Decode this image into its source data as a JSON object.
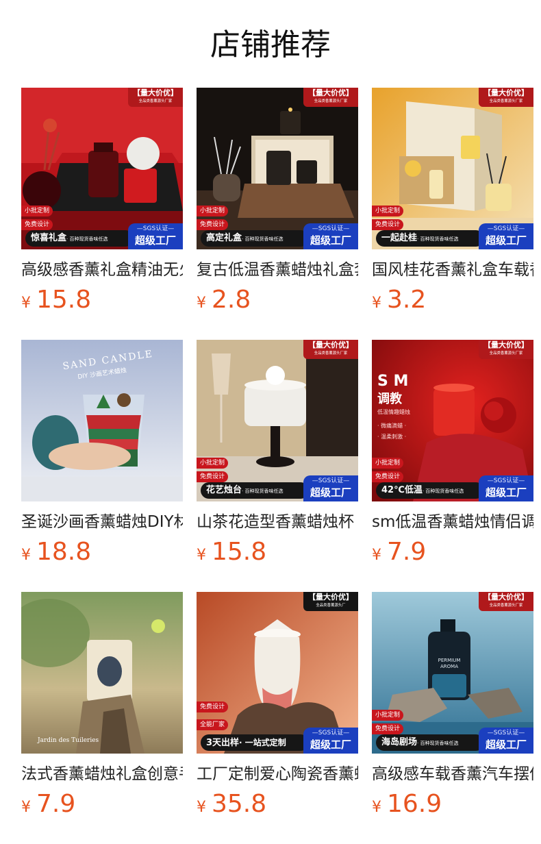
{
  "page": {
    "title": "店铺推荐"
  },
  "products": [
    {
      "name": "高级感香薰礼盒精油无火香薰",
      "currency": "¥",
      "price": "15.8",
      "badges": {
        "top": "【量大价优】",
        "top_sub": "全品类香薰源头厂家",
        "side": [
          "小批定制",
          "免费设计"
        ],
        "bar_main": "惊喜礼盒",
        "bar_sub": "· 百种现货香味任选",
        "factory_top": "—SGS认证—",
        "factory_main": "超级工厂"
      },
      "colors": {
        "bg1": "#c4161c",
        "bg2": "#7a0d10",
        "accent": "#e7e2dc"
      }
    },
    {
      "name": "复古低温香薰蜡烛礼盒套装",
      "currency": "¥",
      "price": "2.8",
      "badges": {
        "top": "【量大价优】",
        "top_sub": "全品类香薰源头厂家",
        "side": [
          "小批定制",
          "免费设计"
        ],
        "bar_main": "高定礼盒",
        "bar_sub": "· 百种现货香味任选",
        "factory_top": "—SGS认证—",
        "factory_main": "超级工厂"
      },
      "colors": {
        "bg1": "#1c1612",
        "bg2": "#5a4331",
        "accent": "#e8dcc8"
      }
    },
    {
      "name": "国风桂花香薰礼盒车载香薰",
      "currency": "¥",
      "price": "3.2",
      "badges": {
        "top": "【量大价优】",
        "top_sub": "全品类香薰源头厂家",
        "side": [
          "小批定制",
          "免费设计"
        ],
        "bar_main": "一起赴桂",
        "bar_sub": "· 百种现货香味任选",
        "factory_top": "—SGS认证—",
        "factory_main": "超级工厂"
      },
      "colors": {
        "bg1": "#e0a237",
        "bg2": "#f4e6c6",
        "accent": "#f3e9d2"
      }
    },
    {
      "name": "圣诞沙画香薰蜡烛DIY材料包",
      "currency": "¥",
      "price": "18.8",
      "badges": {
        "script_title": "SAND CANDLE",
        "script_sub": "DIY 沙画艺术蜡烛"
      },
      "colors": {
        "bg1": "#b7c2db",
        "bg2": "#e6e9f1",
        "accent": "#c8252b"
      }
    },
    {
      "name": "山茶花造型香薰蜡烛杯",
      "currency": "¥",
      "price": "15.8",
      "badges": {
        "top": "【量大价优】",
        "top_sub": "全品类香薰源头厂家",
        "side": [
          "小批定制",
          "免费设计"
        ],
        "bar_main": "花艺烛台",
        "bar_sub": "· 百种现货香味任选",
        "factory_top": "—SGS认证—",
        "factory_main": "超级工厂"
      },
      "colors": {
        "bg1": "#d7c6a6",
        "bg2": "#3a2b22",
        "accent": "#f3f1ec"
      }
    },
    {
      "name": "sm低温香薰蜡烛情侣调情",
      "currency": "¥",
      "price": "7.9",
      "badges": {
        "top": "【量大价优】",
        "top_sub": "全品类香薰源头厂家",
        "side": [
          "小批定制",
          "免费设计"
        ],
        "bar_main": "42℃低温",
        "bar_sub": "· 百种现货香味任选",
        "factory_top": "—SGS认证—",
        "factory_main": "超级工厂",
        "sm_title": "S M",
        "sm_sub": "调教",
        "sm_lines": [
          "低温情趣蜡烛",
          "· 微痛滴蜡 ·",
          "· 温柔刺激 ·"
        ]
      },
      "colors": {
        "bg1": "#8d0d10",
        "bg2": "#d4171c",
        "accent": "#e23a2f"
      }
    },
    {
      "name": "法式香薰蜡烛礼盒创意手工",
      "currency": "¥",
      "price": "7.9",
      "badges": {
        "label_line": "Jardin des Tuileries"
      },
      "colors": {
        "bg1": "#8fa86a",
        "bg2": "#d6c7a2",
        "accent": "#efe7d4"
      }
    },
    {
      "name": "工厂定制爱心陶瓷香薰蜡烛",
      "currency": "¥",
      "price": "35.8",
      "badges": {
        "top": "【量大价优】",
        "top_sub": "全品类香薰源头厂",
        "side": [
          "免费设计",
          "全能厂家"
        ],
        "bar_main": "3天出样",
        "bar_sub": "· 一站式定制",
        "factory_top": "—SGS认证—",
        "factory_main": "超级工厂"
      },
      "colors": {
        "bg1": "#c6582f",
        "bg2": "#f0b089",
        "accent": "#f5f1ea"
      }
    },
    {
      "name": "高级感车载香薰汽车摆件",
      "currency": "¥",
      "price": "16.9",
      "badges": {
        "top": "【量大价优】",
        "top_sub": "全品类香薰源头厂家",
        "side": [
          "小批定制",
          "免费设计"
        ],
        "bar_main": "海岛剧场",
        "bar_sub": "· 百种现货香味任选",
        "factory_top": "—SGS认证—",
        "factory_main": "超级工厂",
        "bottle_label": "PERMIUM AROMA"
      },
      "colors": {
        "bg1": "#2e6f92",
        "bg2": "#9ac6d8",
        "accent": "#1d2a36"
      }
    }
  ]
}
